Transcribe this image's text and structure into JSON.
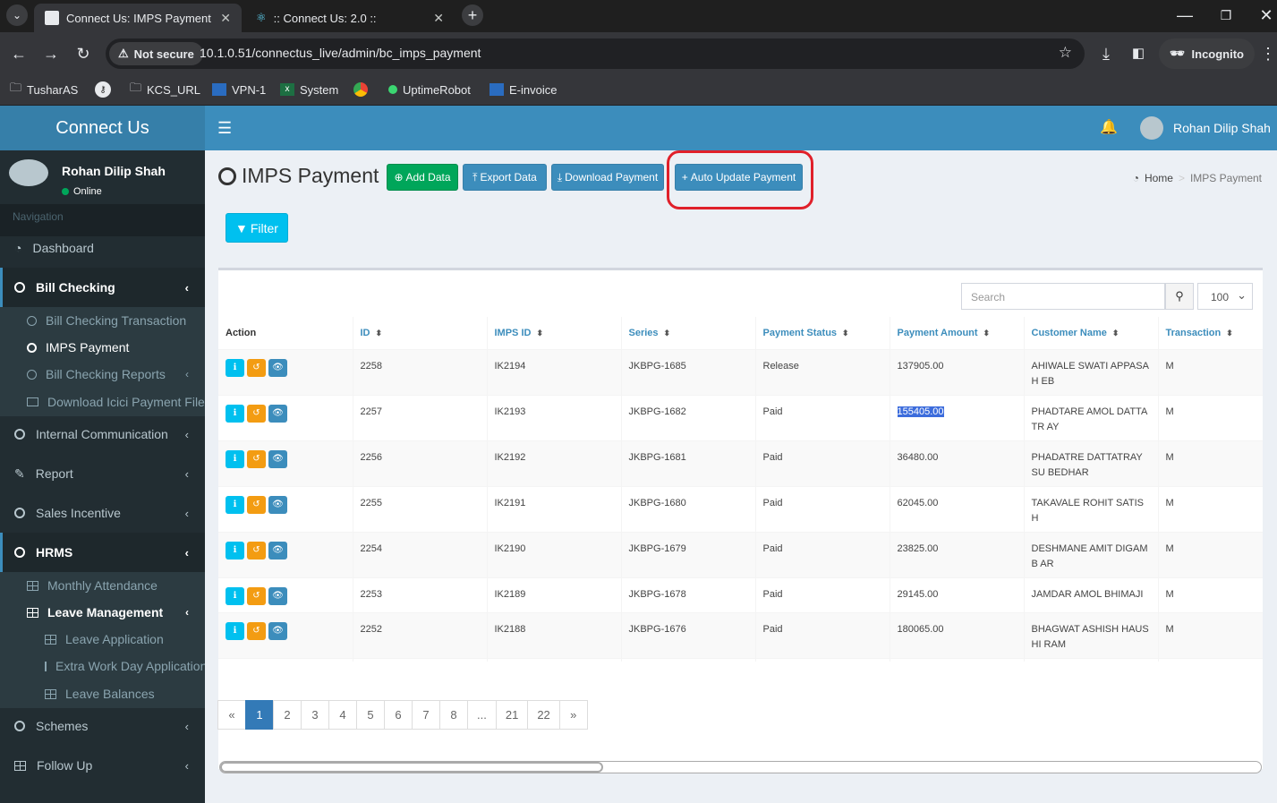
{
  "browser": {
    "tabs": [
      {
        "title": "Connect Us: IMPS Payment",
        "active": true
      },
      {
        "title": ":: Connect Us: 2.0 ::",
        "active": false
      }
    ],
    "security_label": "Not secure",
    "url": "10.1.0.51/connectus_live/admin/bc_imps_payment",
    "profile": "Incognito",
    "bookmarks": [
      "TusharAS",
      "",
      "KCS_URL",
      "VPN-1",
      "System",
      "",
      "UptimeRobot",
      "E-invoice"
    ]
  },
  "app": {
    "brand": "Connect Us",
    "user": {
      "name": "Rohan Dilip Shah",
      "status": "Online"
    },
    "nav_header": "Navigation",
    "nav": [
      {
        "label": "Dashboard",
        "icon": "dashboard-icon"
      },
      {
        "label": "Bill Checking",
        "open": true,
        "icon": "circle-icon"
      },
      {
        "label": "Internal Communication",
        "icon": "circle-icon"
      },
      {
        "label": "Report",
        "icon": "pencil-icon"
      },
      {
        "label": "Sales Incentive",
        "icon": "circle-icon"
      },
      {
        "label": "HRMS",
        "open": true,
        "icon": "circle-icon"
      },
      {
        "label": "Schemes",
        "icon": "circle-icon"
      },
      {
        "label": "Follow Up",
        "icon": "grid-icon"
      }
    ],
    "bill_sub": [
      {
        "label": "Bill Checking Transaction"
      },
      {
        "label": "IMPS Payment",
        "active": true
      },
      {
        "label": "Bill Checking Reports"
      },
      {
        "label": "Download Icici Payment File"
      }
    ],
    "hrms_sub": [
      {
        "label": "Monthly Attendance"
      },
      {
        "label": "Leave Management",
        "active": true
      },
      {
        "label": "Leave Application"
      },
      {
        "label": "Extra Work Day Application"
      },
      {
        "label": "Leave Balances"
      }
    ]
  },
  "page": {
    "title": "IMPS Payment",
    "buttons": {
      "add": "Add Data",
      "export": "Export Data",
      "download": "Download Payment",
      "auto_update": "Auto Update Payment",
      "filter": "Filter"
    },
    "breadcrumb": {
      "home": "Home",
      "current": "IMPS Payment"
    },
    "search_placeholder": "Search",
    "page_length": "100",
    "columns": [
      "Action",
      "ID",
      "IMPS ID",
      "Series",
      "Payment Status",
      "Payment Amount",
      "Customer Name",
      "Transaction"
    ],
    "rows": [
      {
        "id": "2258",
        "imps_id": "IK2194",
        "series": "JKBPG-1685",
        "status": "Release",
        "amount": "137905.00",
        "customer": "AHIWALE SWATI APPASAH EB",
        "transaction": "M"
      },
      {
        "id": "2257",
        "imps_id": "IK2193",
        "series": "JKBPG-1682",
        "status": "Paid",
        "amount": "155405.00",
        "customer": "PHADTARE AMOL DATTATR AY",
        "transaction": "M"
      },
      {
        "id": "2256",
        "imps_id": "IK2192",
        "series": "JKBPG-1681",
        "status": "Paid",
        "amount": "36480.00",
        "customer": "PHADATRE DATTATRAY SU BEDHAR",
        "transaction": "M"
      },
      {
        "id": "2255",
        "imps_id": "IK2191",
        "series": "JKBPG-1680",
        "status": "Paid",
        "amount": "62045.00",
        "customer": "TAKAVALE ROHIT SATISH",
        "transaction": "M"
      },
      {
        "id": "2254",
        "imps_id": "IK2190",
        "series": "JKBPG-1679",
        "status": "Paid",
        "amount": "23825.00",
        "customer": "DESHMANE AMIT DIGAMB AR",
        "transaction": "M"
      },
      {
        "id": "2253",
        "imps_id": "IK2189",
        "series": "JKBPG-1678",
        "status": "Paid",
        "amount": "29145.00",
        "customer": "JAMDAR AMOL BHIMAJI",
        "transaction": "M"
      },
      {
        "id": "2252",
        "imps_id": "IK2188",
        "series": "JKBPG-1676",
        "status": "Paid",
        "amount": "180065.00",
        "customer": "BHAGWAT ASHISH HAUSHI RAM",
        "transaction": "M"
      }
    ],
    "pagination": [
      "«",
      "1",
      "2",
      "3",
      "4",
      "5",
      "6",
      "7",
      "8",
      "...",
      "21",
      "22",
      "»"
    ],
    "active_page": "1"
  }
}
